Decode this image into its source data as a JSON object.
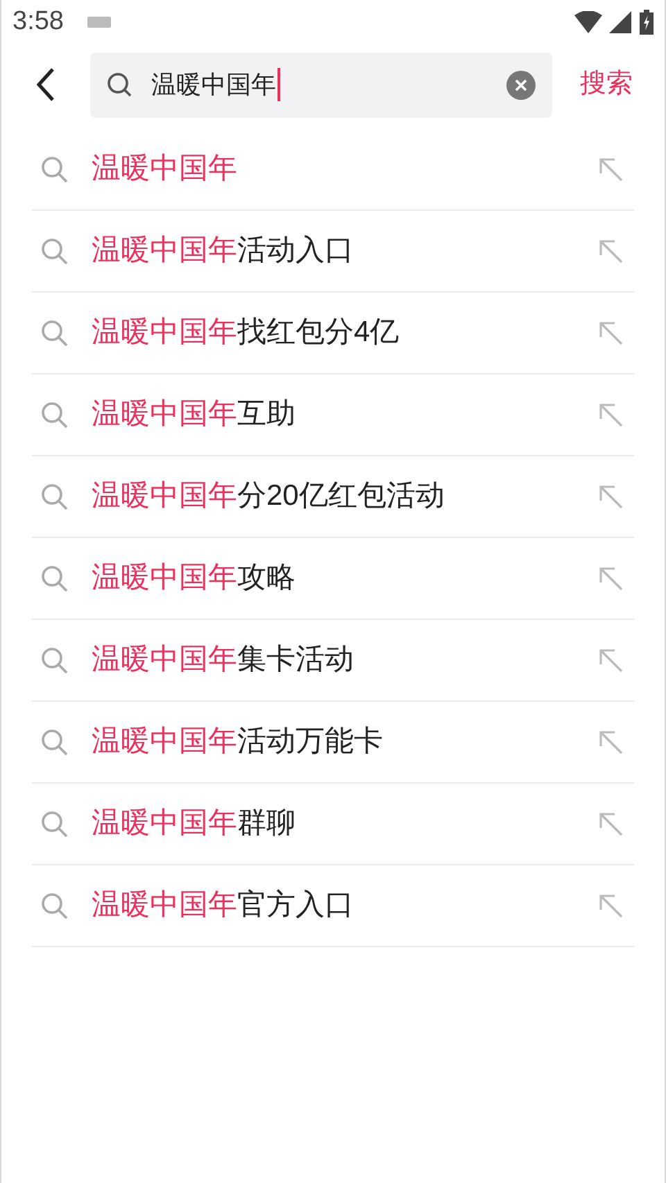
{
  "status_bar": {
    "time": "3:58"
  },
  "search": {
    "value": "温暖中国年",
    "button": "搜索"
  },
  "suggestions": [
    {
      "match": "温暖中国年"
    },
    {
      "match": "温暖中国年",
      "rest": "活动入口"
    },
    {
      "match": "温暖中国年",
      "rest": "找红包分4亿"
    },
    {
      "match": "温暖中国年",
      "rest": "互助"
    },
    {
      "match": "温暖中国年",
      "rest": "分20亿红包活动"
    },
    {
      "match": "温暖中国年",
      "rest": "攻略"
    },
    {
      "match": "温暖中国年",
      "rest": "集卡活动"
    },
    {
      "match": "温暖中国年",
      "rest": "活动万能卡"
    },
    {
      "match": "温暖中国年",
      "rest": "群聊"
    },
    {
      "match": "温暖中国年",
      "rest": "官方入口"
    }
  ]
}
